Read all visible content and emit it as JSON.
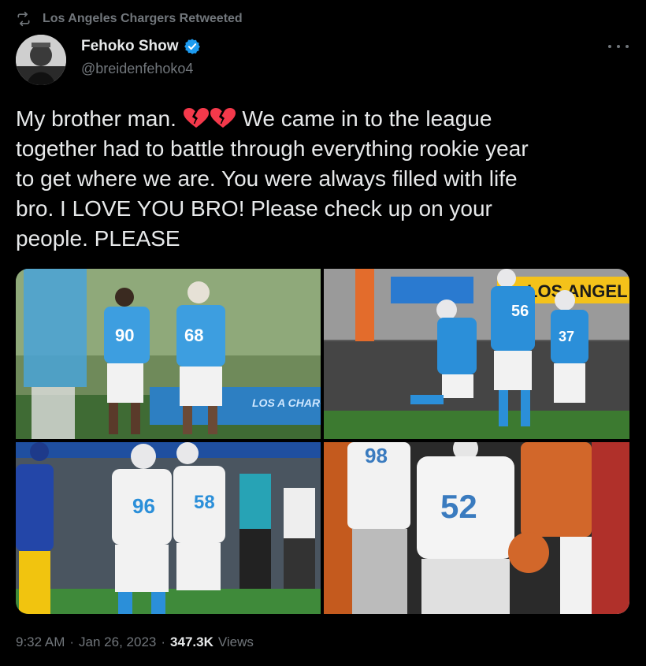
{
  "retweet": {
    "label": "Los Angeles Chargers Retweeted",
    "icon": "retweet-icon"
  },
  "author": {
    "name": "Fehoko Show",
    "handle": "@breidenfehoko4",
    "verified": true
  },
  "tweet": {
    "text_line1_pre": "My brother man. ",
    "text_line1_post": " We came in to the league",
    "text_rest": "together had to battle through everything rookie year\nto get where we are. You were always filled with life\nbro. I LOVE YOU BRO! Please check up on your\npeople. PLEASE",
    "emoji": [
      "broken-heart",
      "broken-heart"
    ]
  },
  "media": [
    {
      "jersey_a": "90",
      "jersey_b": "68",
      "banner": "LOS A CHARG"
    },
    {
      "jersey_a": "56",
      "jersey_b": "37",
      "banner": "LOS ANGEL"
    },
    {
      "jersey_a": "96",
      "jersey_b": "58"
    },
    {
      "jersey_a": "52",
      "jersey_b": "98"
    }
  ],
  "footer": {
    "time": "9:32 AM",
    "sep1": "·",
    "date": "Jan 26, 2023",
    "sep2": "·",
    "views_count": "347.3K",
    "views_label": "Views"
  },
  "colors": {
    "background": "#000000",
    "text": "#e7e9ea",
    "muted": "#71767b",
    "verified": "#1d9bf0",
    "heart": "#f4394b",
    "chargers_blue": "#2b8fd9"
  }
}
